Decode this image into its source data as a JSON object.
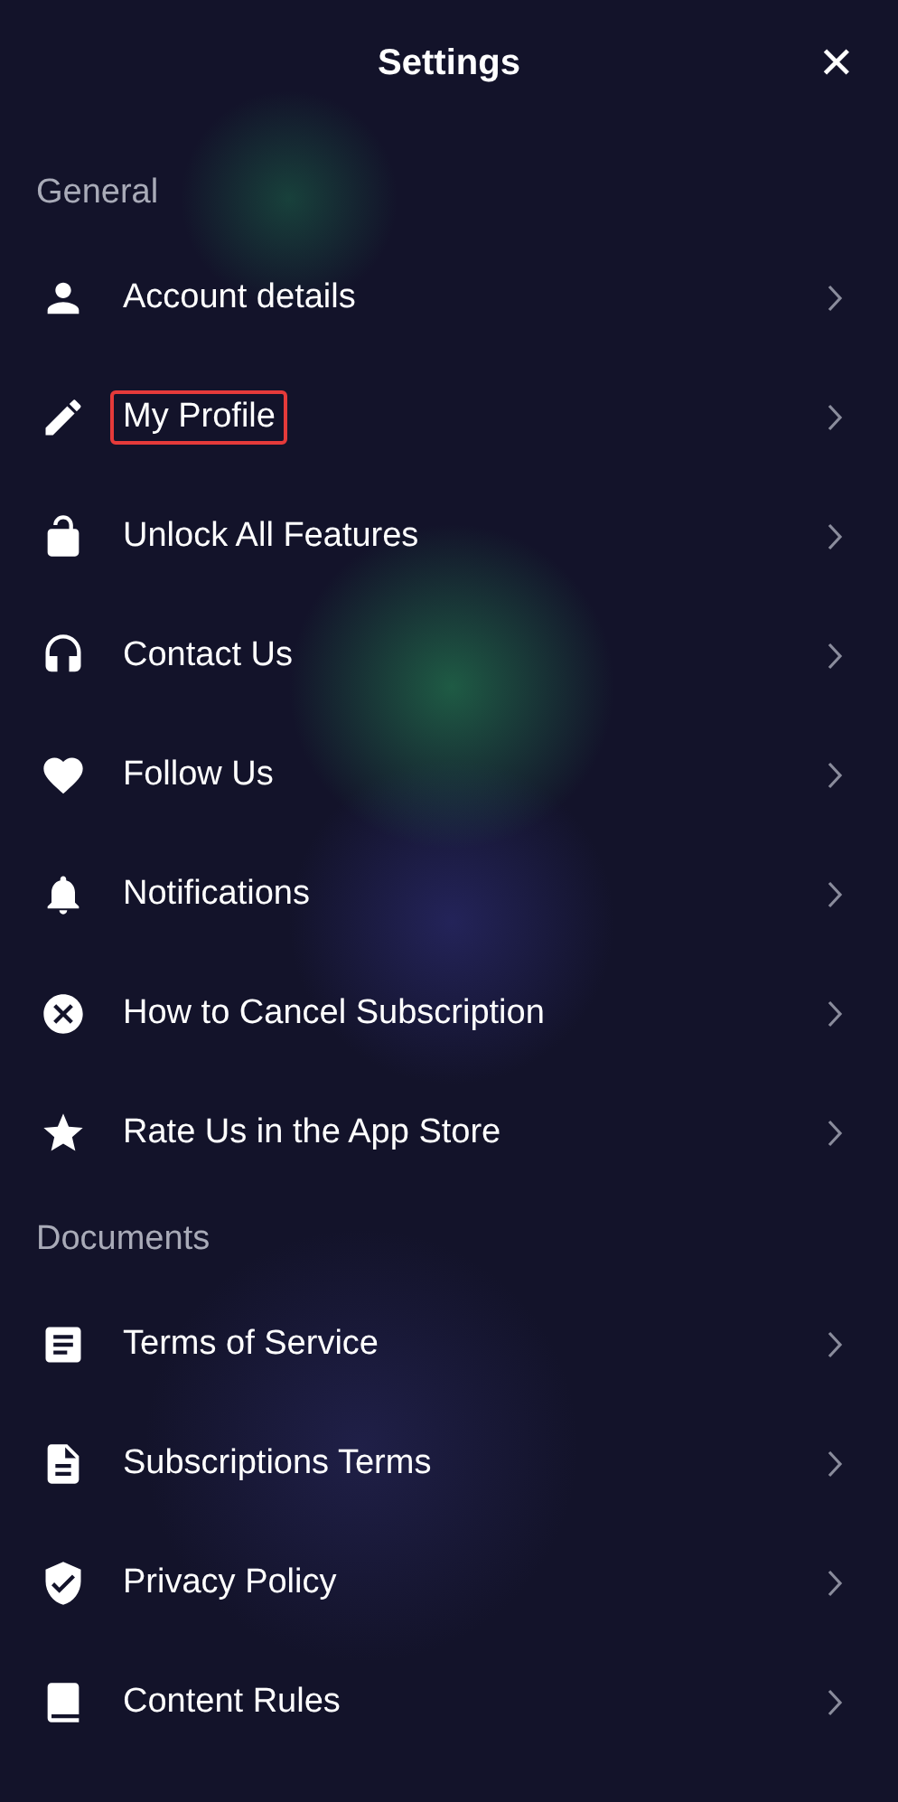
{
  "header": {
    "title": "Settings",
    "close": "✕"
  },
  "sections": [
    {
      "title": "General",
      "items": [
        {
          "label": "Account details",
          "highlighted": false
        },
        {
          "label": "My Profile",
          "highlighted": true
        },
        {
          "label": "Unlock All Features",
          "highlighted": false
        },
        {
          "label": "Contact Us",
          "highlighted": false
        },
        {
          "label": "Follow Us",
          "highlighted": false
        },
        {
          "label": "Notifications",
          "highlighted": false
        },
        {
          "label": "How to Cancel Subscription",
          "highlighted": false
        },
        {
          "label": "Rate Us in the App Store",
          "highlighted": false
        }
      ]
    },
    {
      "title": "Documents",
      "items": [
        {
          "label": "Terms of Service",
          "highlighted": false
        },
        {
          "label": "Subscriptions Terms",
          "highlighted": false
        },
        {
          "label": "Privacy Policy",
          "highlighted": false
        },
        {
          "label": "Content Rules",
          "highlighted": false
        }
      ]
    }
  ]
}
